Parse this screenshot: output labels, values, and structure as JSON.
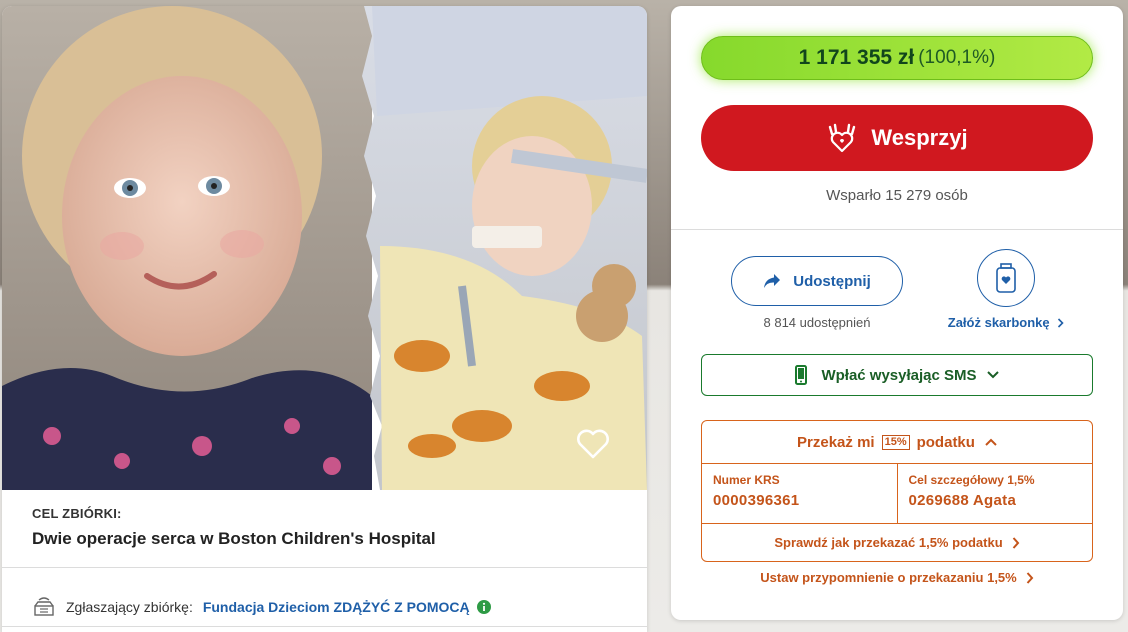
{
  "left": {
    "goal_label": "CEL ZBIÓRKI:",
    "goal_title": "Dwie operacje serca w Boston Children's Hospital",
    "org_prefix": "Zgłaszający zbiórkę:",
    "org_name": "Fundacja Dzieciom ZDĄŻYĆ Z POMOCĄ",
    "icons": [
      "heart-outline-icon",
      "hands-box-icon",
      "info-icon"
    ]
  },
  "right": {
    "amount": "1 171 355 zł",
    "percent": "(100,1%)",
    "progress_fraction": 1.001,
    "support_label": "Wesprzyj",
    "supporters": "Wsparło 15 279 osób",
    "share_label": "Udostępnij",
    "share_count": "8 814 udostępnień",
    "piggy_link": "Załóż skarbonkę",
    "sms_label": "Wpłać wysyłając SMS",
    "tax": {
      "title_before": "Przekaż mi",
      "badge": "15%",
      "title_after": "podatku",
      "krs_label": "Numer KRS",
      "krs_value": "0000396361",
      "goal_label": "Cel szczegółowy 1,5%",
      "goal_value": "0269688 Agata",
      "check_label": "Sprawdź jak przekazać 1,5% podatku"
    },
    "reminder_label": "Ustaw przypomnienie o przekazaniu 1,5%",
    "colors": {
      "progress": "#9be03a",
      "support": "#d0181f",
      "link": "#1f5fa8",
      "sms": "#1a7a2d",
      "tax": "#c4541a"
    }
  }
}
